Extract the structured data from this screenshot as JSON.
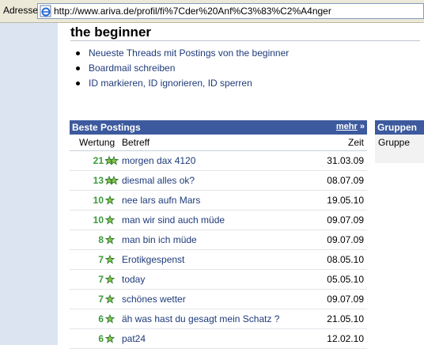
{
  "browser": {
    "address_label": "Adresse",
    "url": "http://www.ariva.de/profil/fi%7Cder%20Anf%C3%83%C2%A4nger"
  },
  "profile": {
    "title": "the beginner",
    "links": [
      {
        "label": "Neueste Threads mit Postings von the beginner"
      },
      {
        "label": "Boardmail schreiben"
      },
      {
        "label": "ID markieren, ID ignorieren, ID sperren"
      }
    ]
  },
  "postings": {
    "title": "Beste Postings",
    "more_label": "mehr",
    "more_arrow": "»",
    "columns": {
      "rating": "Wertung",
      "subject": "Betreff",
      "time": "Zeit"
    },
    "rows": [
      {
        "score": "21",
        "stars": 2,
        "subject": "morgen dax 4120",
        "date": "31.03.09"
      },
      {
        "score": "13",
        "stars": 2,
        "subject": "diesmal alles ok?",
        "date": "08.07.09"
      },
      {
        "score": "10",
        "stars": 1,
        "subject": "nee lars aufn Mars",
        "date": "19.05.10"
      },
      {
        "score": "10",
        "stars": 1,
        "subject": "man wir sind auch müde",
        "date": "09.07.09"
      },
      {
        "score": "8",
        "stars": 1,
        "subject": "man bin ich müde",
        "date": "09.07.09"
      },
      {
        "score": "7",
        "stars": 1,
        "subject": "Erotikgespenst",
        "date": "08.05.10"
      },
      {
        "score": "7",
        "stars": 1,
        "subject": "today",
        "date": "05.05.10"
      },
      {
        "score": "7",
        "stars": 1,
        "subject": "schönes wetter",
        "date": "09.07.09"
      },
      {
        "score": "6",
        "stars": 1,
        "subject": "äh was hast du gesagt mein Schatz ?",
        "date": "21.05.10"
      },
      {
        "score": "6",
        "stars": 1,
        "subject": "pat24",
        "date": "12.02.10"
      }
    ]
  },
  "groups": {
    "title": "Gruppen",
    "column": "Gruppe"
  },
  "colors": {
    "header_blue": "#3d5a9e",
    "link_blue": "#1f3b7a",
    "score_green": "#3a9a3a",
    "sidebar_blue": "#dde4f1"
  }
}
